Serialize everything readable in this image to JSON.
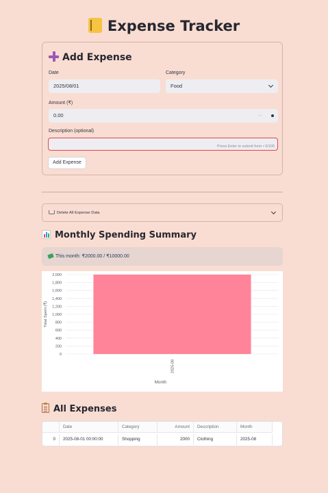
{
  "header": {
    "title": "Expense Tracker",
    "icon": "notebook-icon"
  },
  "form": {
    "header": "Add Expense",
    "date_label": "Date",
    "date_value": "2025/08/01",
    "category_label": "Category",
    "category_value": "Food",
    "amount_label": "Amount (₹)",
    "amount_value": "0.00",
    "amount_minus": "–",
    "description_label": "Description (optional)",
    "description_value": "",
    "description_hint": "Press Enter to submit form • 0/100",
    "submit_label": "Add Expense"
  },
  "danger": {
    "expander_label": "Delete All Expense Data"
  },
  "summary": {
    "title": "Monthly Spending Summary",
    "info": "This month: ₹2000.00 / ₹10000.00"
  },
  "chart_data": {
    "type": "bar",
    "categories": [
      "2025-08"
    ],
    "values": [
      2000
    ],
    "xlabel": "Month",
    "ylabel": "Total Spent (₹)",
    "ylim": [
      0,
      2000
    ],
    "yticks": [
      0,
      200,
      400,
      600,
      800,
      1000,
      1200,
      1400,
      1600,
      1800,
      2000
    ],
    "grid": true,
    "bar_color": "#ff8499"
  },
  "expenses": {
    "title": "All Expenses",
    "columns": [
      "",
      "Date",
      "Category",
      "Amount",
      "Description",
      "Month"
    ],
    "rows": [
      [
        "0",
        "2025-08-01 00:00:00",
        "Shopping",
        "2000",
        "Clothing",
        "2025-08"
      ]
    ]
  },
  "colors": {
    "background": "#f9ddd2",
    "accent": "#9b59b6",
    "error_border": "#e0464b"
  }
}
